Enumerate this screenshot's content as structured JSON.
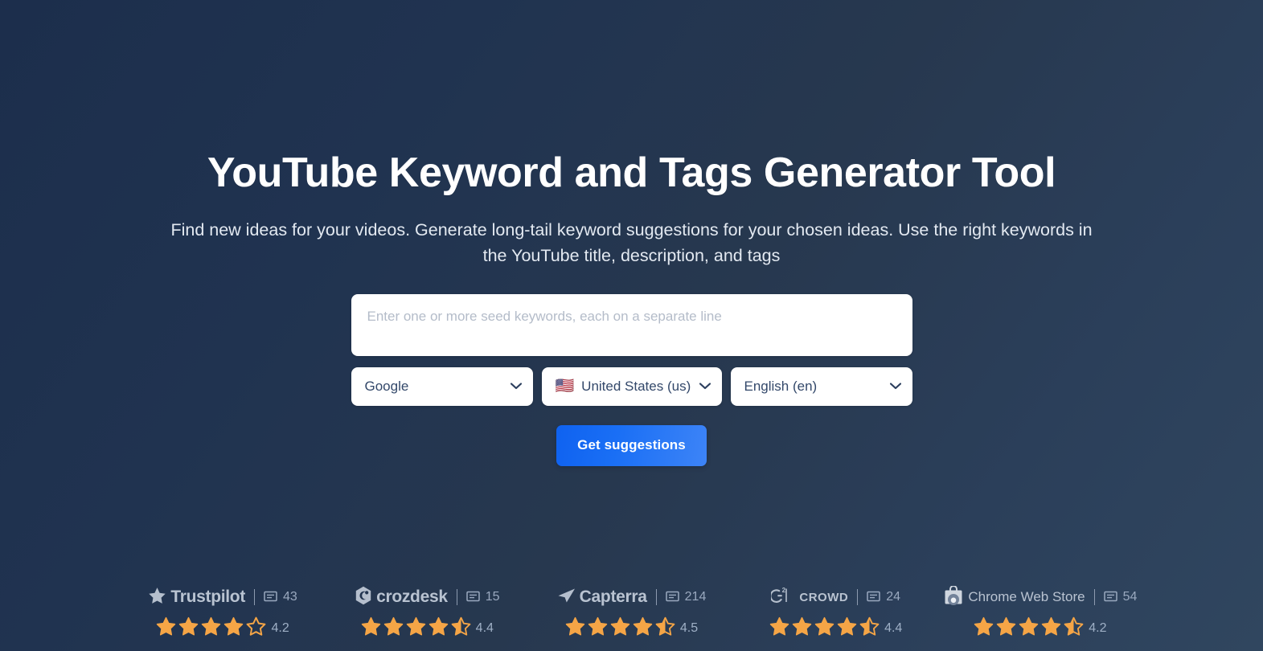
{
  "hero": {
    "title": "YouTube Keyword and Tags Generator Tool",
    "subtitle": "Find new ideas for your videos. Generate long-tail keyword suggestions for your chosen ideas. Use the right keywords in the YouTube title, description, and tags"
  },
  "form": {
    "seed_input": {
      "placeholder": "Enter one or more seed keywords, each on a separate line",
      "value": ""
    },
    "engine_select": {
      "value": "Google",
      "icon": "chevron-down-icon"
    },
    "country_select": {
      "value": "United States (us)",
      "flag": "🇺🇸",
      "icon": "chevron-down-icon"
    },
    "language_select": {
      "value": "English (en)",
      "icon": "chevron-down-icon"
    },
    "submit_label": "Get suggestions"
  },
  "badges": [
    {
      "name": "Trustpilot",
      "logo_icon": "trustpilot-star-icon",
      "review_count": "43",
      "review_icon": "comment-icon",
      "rating": "4.2",
      "stars_full": 4,
      "stars_half": 0,
      "stars_empty": 1
    },
    {
      "name": "crozdesk",
      "logo_icon": "crozdesk-hex-icon",
      "review_count": "15",
      "review_icon": "comment-icon",
      "rating": "4.4",
      "stars_full": 4,
      "stars_half": 1,
      "stars_empty": 0
    },
    {
      "name": "Capterra",
      "logo_icon": "capterra-arrow-icon",
      "review_count": "214",
      "review_icon": "comment-icon",
      "rating": "4.5",
      "stars_full": 4,
      "stars_half": 1,
      "stars_empty": 0
    },
    {
      "name": "CROWD",
      "logo_icon": "g2-crowd-icon",
      "review_count": "24",
      "review_icon": "comment-icon",
      "rating": "4.4",
      "stars_full": 4,
      "stars_half": 1,
      "stars_empty": 0
    },
    {
      "name": "Chrome Web Store",
      "logo_icon": "chrome-web-store-bag-icon",
      "review_count": "54",
      "review_icon": "comment-icon",
      "rating": "4.2",
      "stars_full": 4,
      "stars_half": 1,
      "stars_empty": 0
    }
  ],
  "colors": {
    "background_dark": "#1c2e4c",
    "background_light": "#30465f",
    "accent_blue": "#1a6ff5",
    "star_orange": "#f5a546",
    "text_muted": "#9fb0c6"
  }
}
